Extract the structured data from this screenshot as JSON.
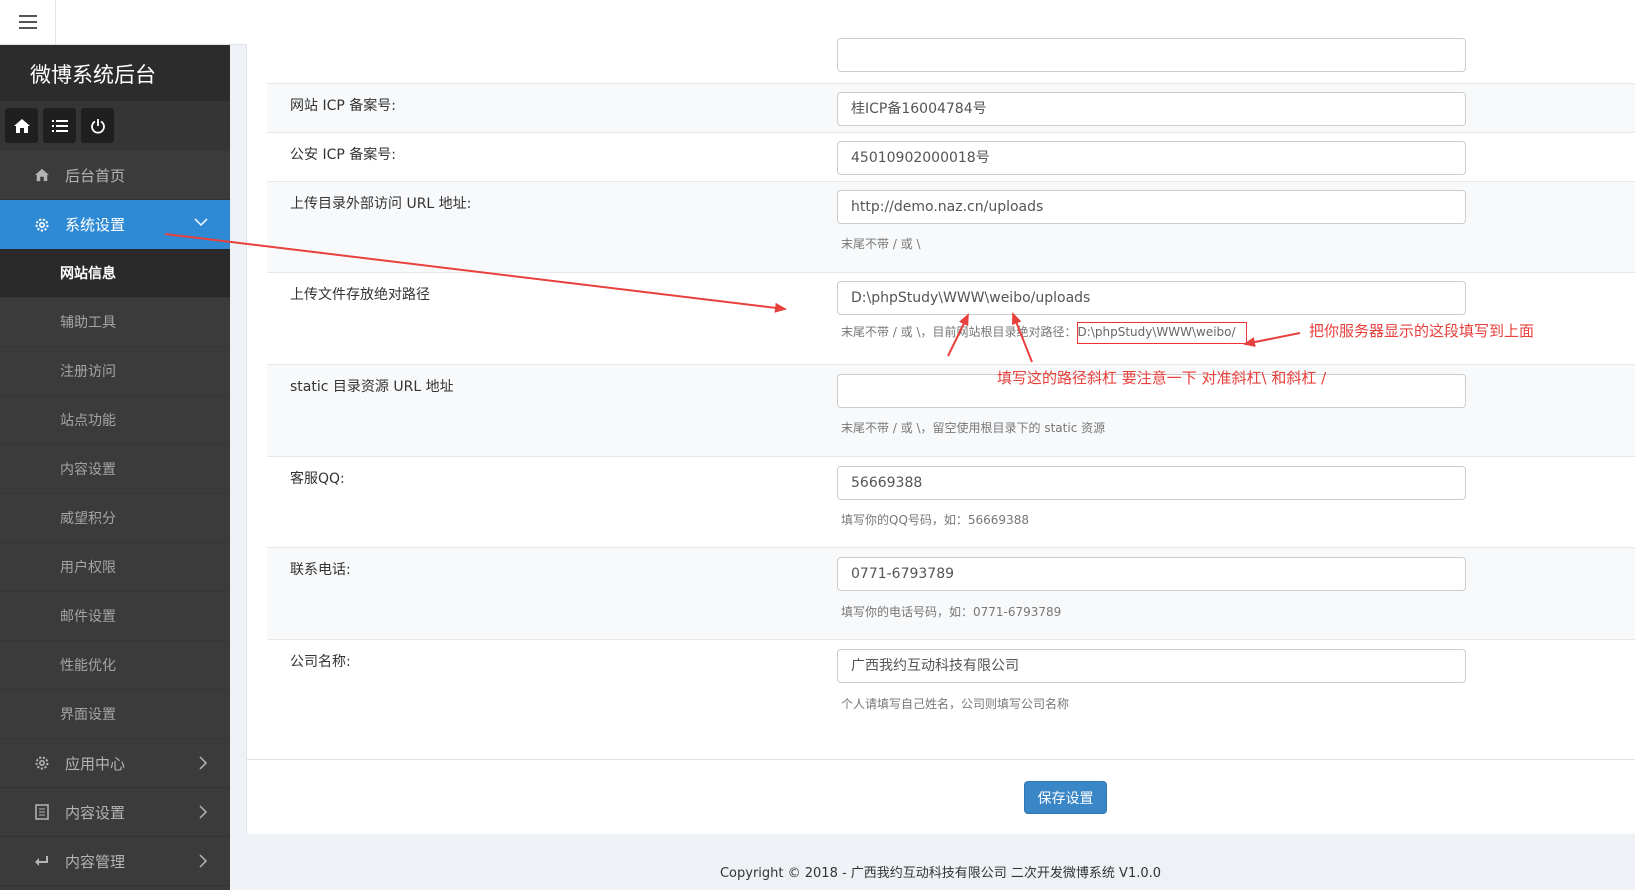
{
  "sidebar": {
    "brand": "微博系统后台",
    "quick": [
      "home-icon",
      "list-icon",
      "power-icon"
    ],
    "items": [
      {
        "label": "后台首页",
        "icon": "home-icon"
      },
      {
        "label": "系统设置",
        "icon": "gear-icon"
      }
    ],
    "sub_items": [
      "网站信息",
      "辅助工具",
      "注册访问",
      "站点功能",
      "内容设置",
      "威望积分",
      "用户权限",
      "邮件设置",
      "性能优化",
      "界面设置"
    ],
    "bottom_items": [
      {
        "label": "应用中心",
        "icon": "gear-icon"
      },
      {
        "label": "内容设置",
        "icon": "document-icon"
      },
      {
        "label": "内容管理",
        "icon": "reply-icon"
      }
    ]
  },
  "form": {
    "icp_label": "网站 ICP 备案号:",
    "icp_value": "桂ICP备16004784号",
    "police_label": "公安 ICP 备案号:",
    "police_value": "45010902000018号",
    "upload_url_label": "上传目录外部访问 URL 地址:",
    "upload_url_value": "http://demo.naz.cn/uploads",
    "upload_url_hint": "末尾不带 / 或 \\",
    "upload_path_label": "上传文件存放绝对路径",
    "upload_path_value": "D:\\phpStudy\\WWW\\weibo/uploads",
    "upload_path_hint": "末尾不带 / 或 \\，目前网站根目录绝对路径：",
    "upload_path_root": "D:\\phpStudy\\WWW\\weibo/",
    "static_label": "static 目录资源 URL 地址",
    "static_value": "",
    "static_hint": "末尾不带 / 或 \\，留空使用根目录下的 static 资源",
    "qq_label": "客服QQ:",
    "qq_value": "56669388",
    "qq_hint": "填写你的QQ号码，如：56669388",
    "phone_label": "联系电话:",
    "phone_value": "0771-6793789",
    "phone_hint": "填写你的电话号码，如：0771-6793789",
    "company_label": "公司名称:",
    "company_value": "广西我约互动科技有限公司",
    "company_hint": "个人请填写自己姓名，公司则填写公司名称",
    "save_label": "保存设置"
  },
  "footer": {
    "copyright": "Copyright © 2018 - 广西我约互动科技有限公司 二次开发微博系统 V1.0.0"
  },
  "annotations": {
    "note_right": "把你服务器显示的这段填写到上面",
    "note_slash": "填写这的路径斜杠  要注意一下 对准斜杠\\  和斜杠 /"
  },
  "colors": {
    "accent": "#2f8ad5",
    "annotation": "#e8403c"
  }
}
